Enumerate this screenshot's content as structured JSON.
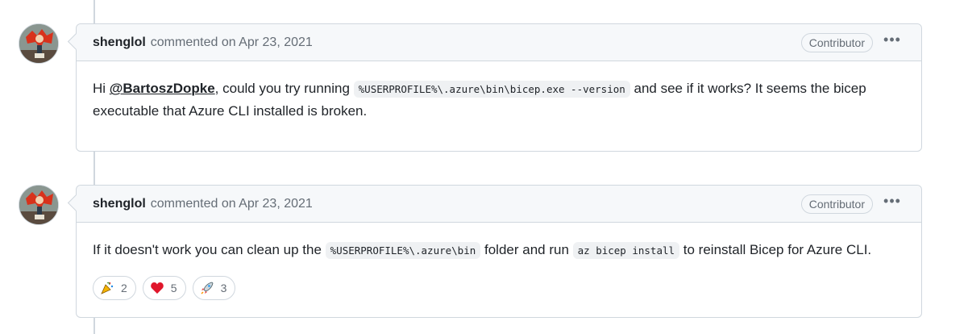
{
  "comments": [
    {
      "author": "shenglol",
      "meta": "commented on Apr 23, 2021",
      "badge": "Contributor",
      "more_icon": "kebab-horizontal-icon",
      "body": {
        "t1": "Hi ",
        "mention": "@BartoszDopke",
        "t2": ", could you try running ",
        "code1": "%USERPROFILE%\\.azure\\bin\\bicep.exe --version",
        "t3": " and see if it works? It seems the bicep executable that Azure CLI installed is broken."
      }
    },
    {
      "author": "shenglol",
      "meta": "commented on Apr 23, 2021",
      "badge": "Contributor",
      "more_icon": "kebab-horizontal-icon",
      "body": {
        "t1": "If it doesn't work you can clean up the ",
        "code1": "%USERPROFILE%\\.azure\\bin",
        "t2": " folder and run ",
        "code2": "az bicep install",
        "t3": " to reinstall Bicep for Azure CLI."
      },
      "reactions": [
        {
          "icon": "tada-icon",
          "count": "2"
        },
        {
          "icon": "heart-icon",
          "count": "5"
        },
        {
          "icon": "rocket-icon",
          "count": "3"
        }
      ]
    }
  ]
}
